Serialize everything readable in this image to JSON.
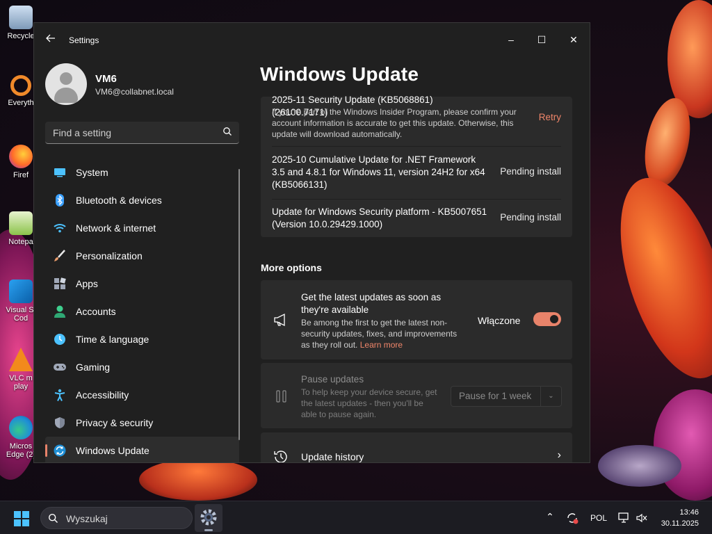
{
  "desktop": {
    "icons": [
      {
        "label": "Recycle"
      },
      {
        "label": "Everyth"
      },
      {
        "label": "Firef"
      },
      {
        "label": "Notepa"
      },
      {
        "label": "Visual St Cod"
      },
      {
        "label": "VLC m play"
      },
      {
        "label": "Micros Edge (2)"
      }
    ]
  },
  "window": {
    "app_title": "Settings",
    "controls": {
      "minimize": "–",
      "maximize": "☐",
      "close": "✕"
    }
  },
  "profile": {
    "name": "VM6",
    "email": "VM6@collabnet.local"
  },
  "search": {
    "placeholder": "Find a setting"
  },
  "nav": {
    "items": [
      {
        "label": "System",
        "icon": "monitor-icon",
        "color": "#4cc2ff"
      },
      {
        "label": "Bluetooth & devices",
        "icon": "bluetooth-icon",
        "color": "#3aa0ff"
      },
      {
        "label": "Network & internet",
        "icon": "wifi-icon",
        "color": "#4cc2ff"
      },
      {
        "label": "Personalization",
        "icon": "brush-icon",
        "color": "#e89a6a"
      },
      {
        "label": "Apps",
        "icon": "apps-icon",
        "color": "#a0a8b8"
      },
      {
        "label": "Accounts",
        "icon": "person-icon",
        "color": "#3ecf8e"
      },
      {
        "label": "Time & language",
        "icon": "globe-clock-icon",
        "color": "#4cc2ff"
      },
      {
        "label": "Gaming",
        "icon": "gamepad-icon",
        "color": "#a0a8b8"
      },
      {
        "label": "Accessibility",
        "icon": "accessibility-icon",
        "color": "#4cc2ff"
      },
      {
        "label": "Privacy & security",
        "icon": "shield-icon",
        "color": "#a0a8b8"
      },
      {
        "label": "Windows Update",
        "icon": "sync-icon",
        "color": "#4cc2ff"
      }
    ],
    "active_index": 10
  },
  "page": {
    "title": "Windows Update"
  },
  "updates": [
    {
      "title": "2025-11 Security Update (KB5068861) (26100.7171)",
      "description": "If you're part of the Windows Insider Program, please confirm your account information is accurate to get this update. Otherwise, this update will download automatically.",
      "status": "Retry"
    },
    {
      "title": "2025-10 Cumulative Update for .NET Framework 3.5 and 4.8.1 for Windows 11, version 24H2 for x64 (KB5066131)",
      "status": "Pending install"
    },
    {
      "title": "Update for Windows Security platform - KB5007651 (Version 10.0.29429.1000)",
      "status": "Pending install"
    }
  ],
  "more_options": {
    "heading": "More options",
    "latest_updates": {
      "title": "Get the latest updates as soon as they're available",
      "description": "Be among the first to get the latest non-security updates, fixes, and improvements as they roll out.",
      "link": "Learn more",
      "toggle_label": "Włączone",
      "toggle_on": true
    },
    "pause_updates": {
      "title": "Pause updates",
      "description": "To help keep your device secure, get the latest updates - then you'll be able to pause again.",
      "select_value": "Pause for 1 week"
    },
    "update_history": {
      "title": "Update history"
    }
  },
  "taskbar": {
    "search_placeholder": "Wyszukaj",
    "language": "POL",
    "time": "13:46",
    "date": "30.11.2025"
  },
  "colors": {
    "accent": "#e8836a",
    "window_bg": "#202020",
    "card_bg": "#2b2b2b"
  }
}
